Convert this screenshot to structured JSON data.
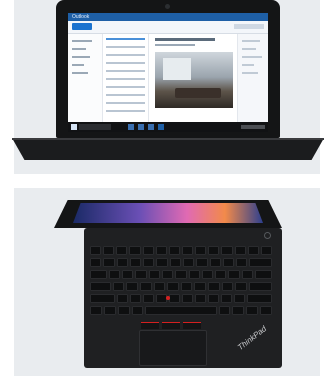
{
  "laptop_front": {
    "screen": {
      "app_name": "Outlook",
      "photo_description": ""
    }
  },
  "laptop_top": {
    "brand_mark": "ThinkPad"
  },
  "colors": {
    "panel_background": "#e9ecef",
    "laptop_body": "#1b1c1e",
    "trackpoint_red": "#d42020",
    "outlook_blue": "#1e5fa6"
  }
}
